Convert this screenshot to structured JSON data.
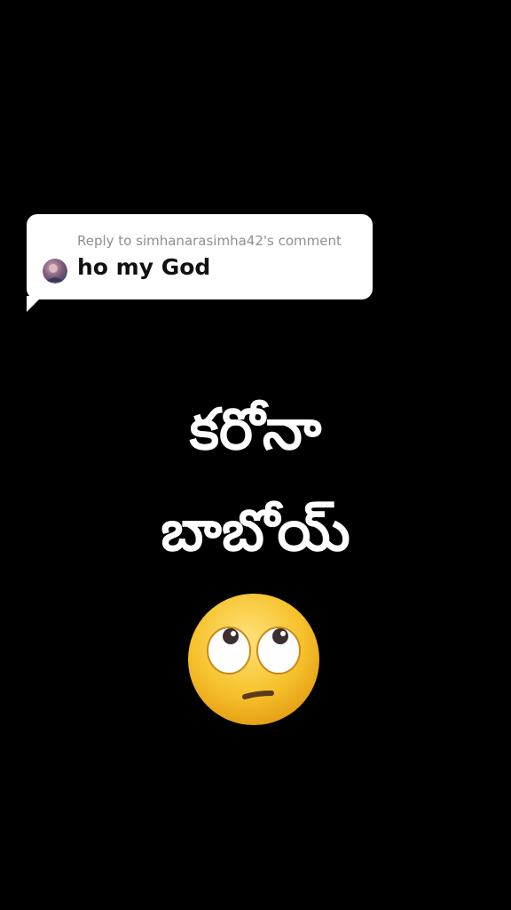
{
  "reply": {
    "header": "Reply to simhanarasimha42's comment",
    "comment": "ho my God"
  },
  "caption": {
    "line1": "కరోనా",
    "line2": "బాబోయ్"
  },
  "emoji": {
    "name": "face-with-rolling-eyes-icon",
    "colors": {
      "face": "#f6c22c",
      "eye_white": "#ffffff",
      "pupil": "#3b2f2f",
      "mouth": "#5a3a1a"
    }
  },
  "colors": {
    "background": "#000000",
    "bubble": "#ffffff",
    "header_text": "#8f8f8f",
    "comment_text": "#111111",
    "caption_text": "#ffffff"
  }
}
